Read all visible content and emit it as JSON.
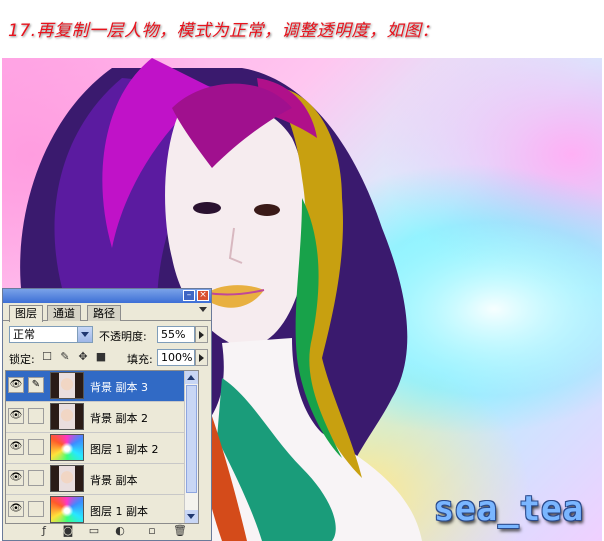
{
  "caption": "17.再复制一层人物，模式为正常，调整透明度，如图：",
  "watermark": "sea_tea",
  "panel": {
    "tabs": [
      "图层",
      "通道",
      "路径"
    ],
    "blend_mode": "正常",
    "opacity_label": "不透明度:",
    "opacity_value": "55%",
    "lock_label": "锁定:",
    "fill_label": "填充:",
    "fill_value": "100%",
    "layers": [
      {
        "name": "背景 副本 3",
        "thumb": "face",
        "selected": true
      },
      {
        "name": "背景 副本 2",
        "thumb": "face",
        "selected": false
      },
      {
        "name": "图层 1 副本 2",
        "thumb": "color",
        "selected": false
      },
      {
        "name": "背景 副本",
        "thumb": "face",
        "selected": false
      },
      {
        "name": "图层 1 副本",
        "thumb": "color",
        "selected": false
      }
    ],
    "icons": {
      "minimize": "minimize-icon",
      "close": "close-icon",
      "eye": "eye-icon",
      "brush": "brush-icon"
    }
  },
  "colors": {
    "caption": "#e8131d",
    "selection": "#316ac5",
    "titlebar": "#3d6fd6"
  }
}
